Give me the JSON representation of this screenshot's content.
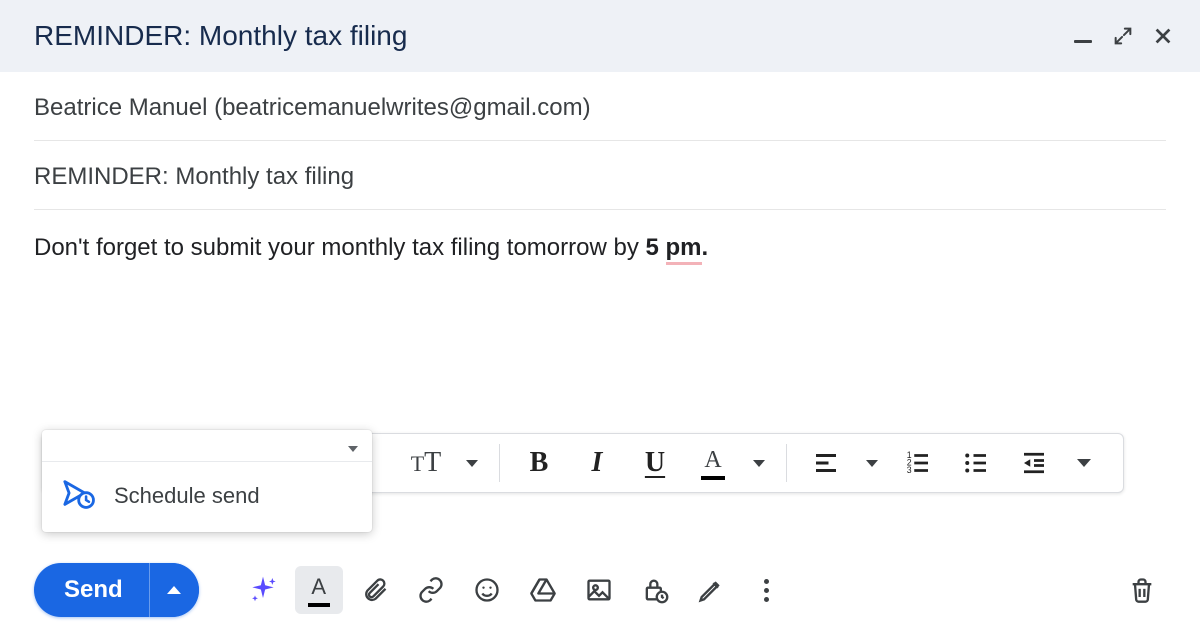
{
  "header": {
    "title": "REMINDER: Monthly tax filing"
  },
  "recipient": "Beatrice Manuel (beatricemanuelwrites@gmail.com)",
  "subject": "REMINDER: Monthly tax filing",
  "body": {
    "prefix": "Don't forget to submit your monthly tax filing tomorrow by ",
    "bold_part": "5 ",
    "bold_spell_part": "pm",
    "suffix": "."
  },
  "schedule_popup": {
    "item_label": "Schedule send"
  },
  "send": {
    "label": "Send"
  }
}
